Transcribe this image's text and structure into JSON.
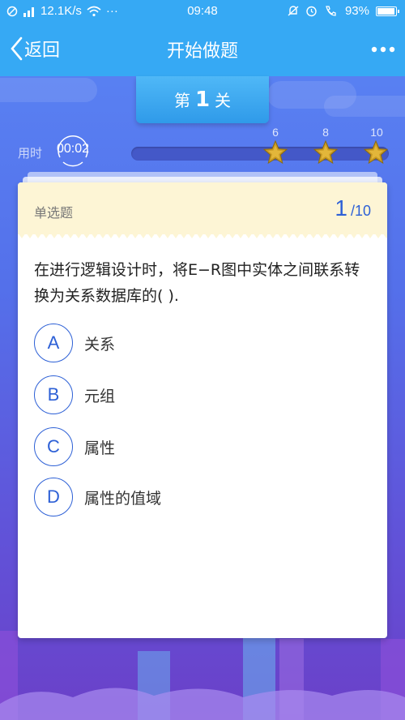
{
  "status_bar": {
    "network_speed": "12.1K/s",
    "time": "09:48",
    "battery": "93%"
  },
  "nav": {
    "back_label": "返回",
    "title": "开始做题"
  },
  "level": {
    "prefix": "第",
    "number": "1",
    "suffix": "关"
  },
  "timer": {
    "label": "用时",
    "value": "00:02"
  },
  "progress": {
    "milestones": [
      "6",
      "8",
      "10"
    ],
    "fill_fraction": 0.0
  },
  "question": {
    "type": "单选题",
    "current": "1",
    "total": "/10",
    "text": "在进行逻辑设计时，将E−R图中实体之间联系转换为关系数据库的( ).",
    "options": [
      {
        "letter": "A",
        "text": "关系"
      },
      {
        "letter": "B",
        "text": "元组"
      },
      {
        "letter": "C",
        "text": "属性"
      },
      {
        "letter": "D",
        "text": "属性的值域"
      }
    ]
  },
  "colors": {
    "header_blue": "#36a9f4",
    "accent": "#2d60d6",
    "card_header": "#fdf5d5",
    "star_gold": "#d9a92a"
  }
}
